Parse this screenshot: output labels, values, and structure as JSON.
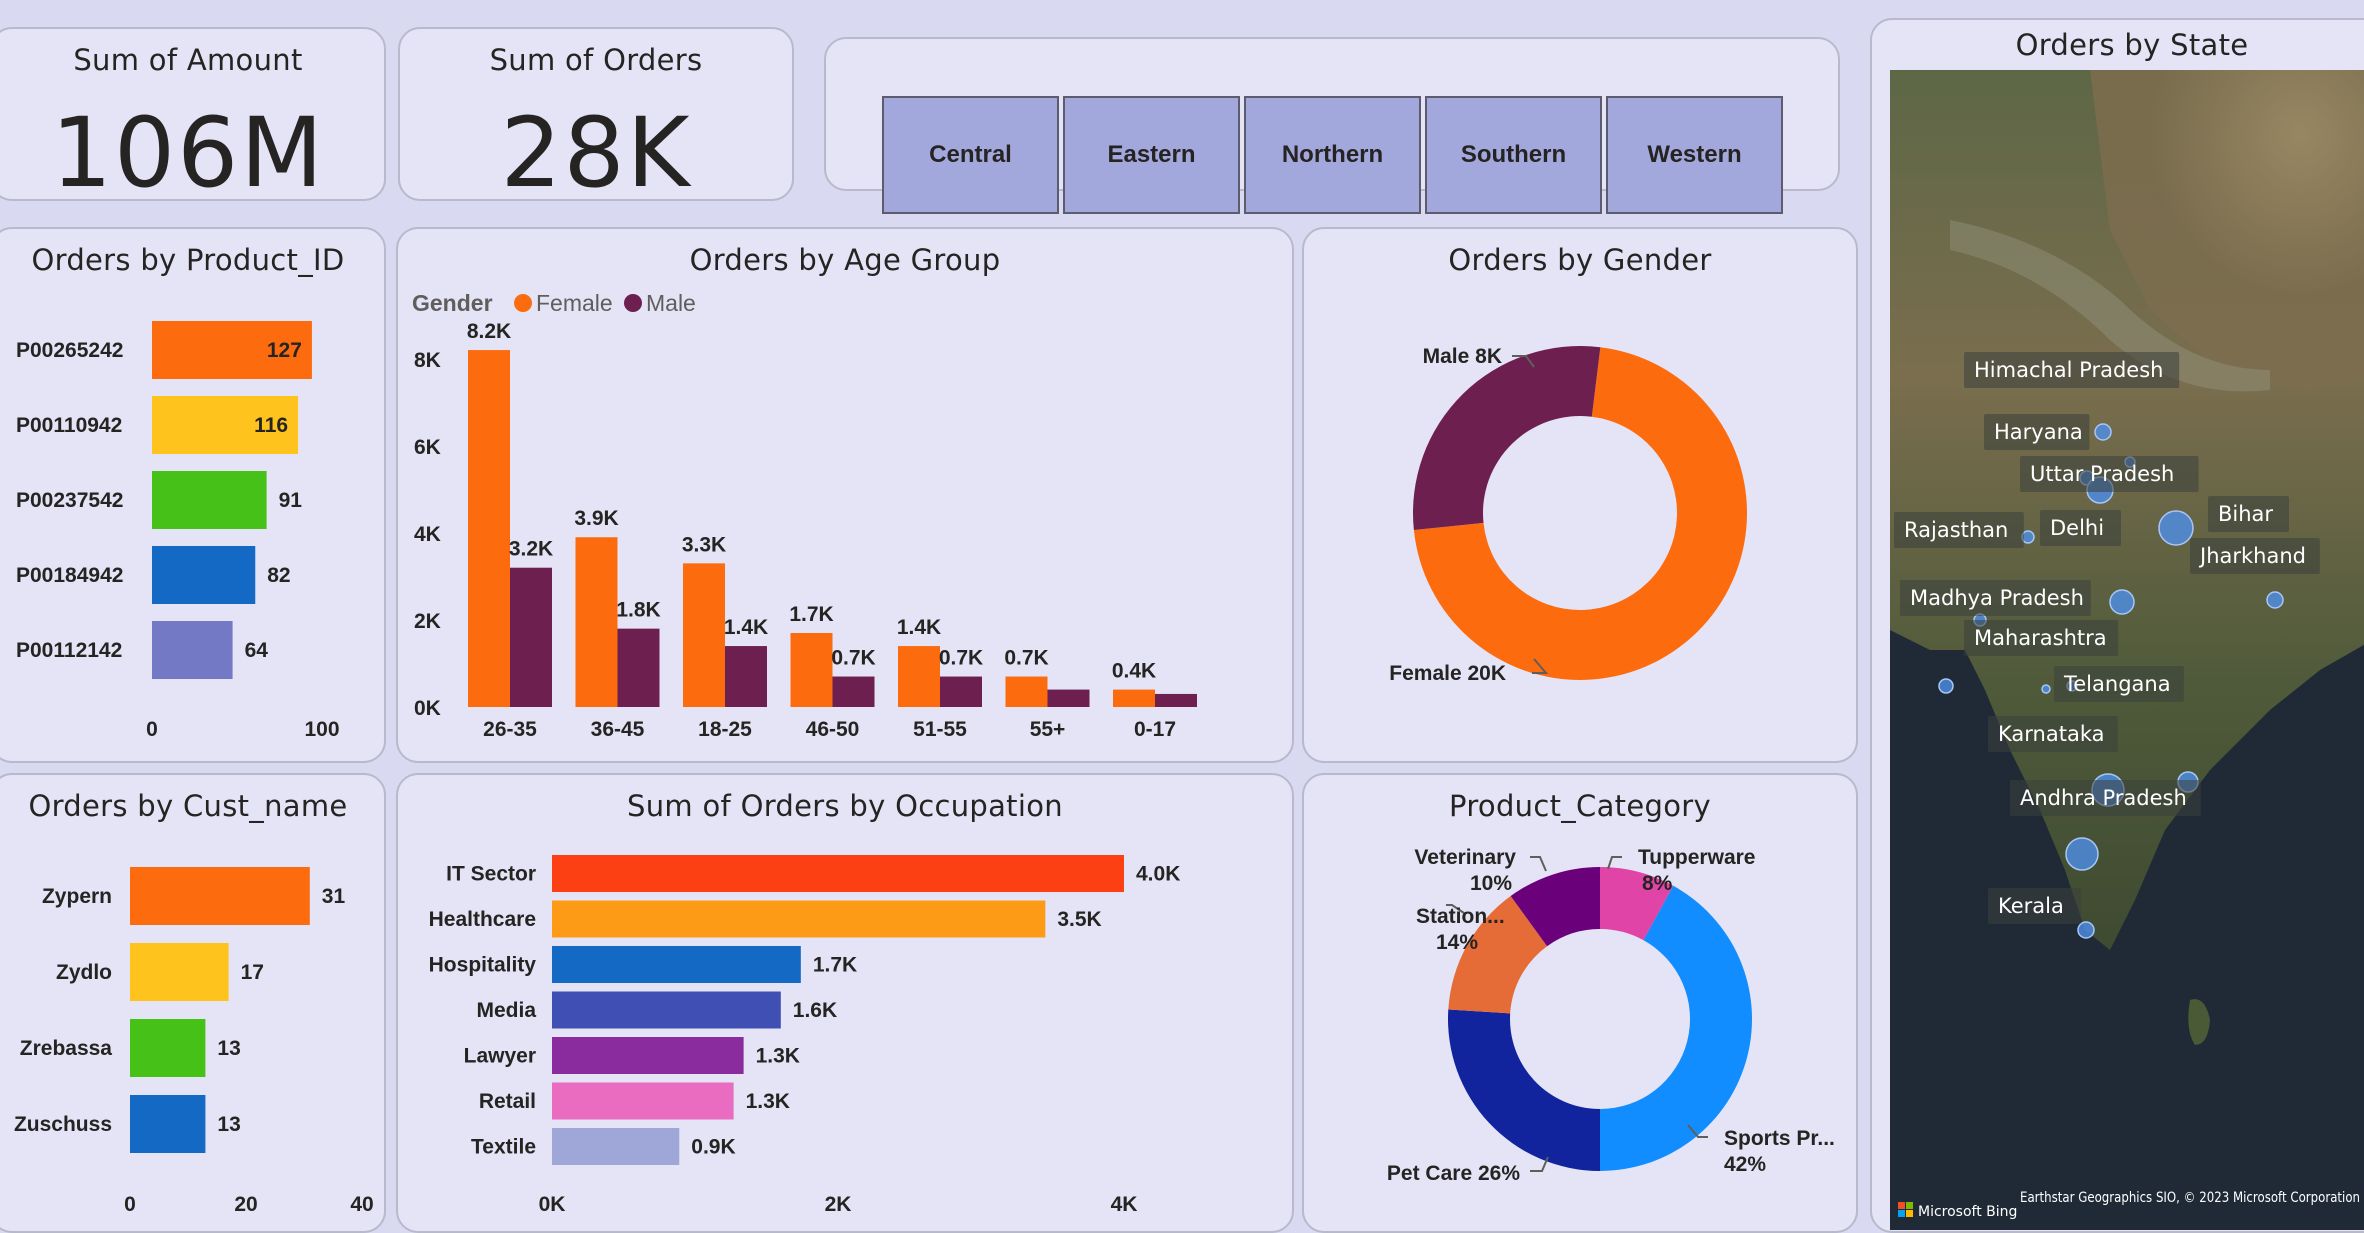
{
  "kpis": {
    "amount": {
      "title": "Sum of Amount",
      "value": "106M"
    },
    "orders": {
      "title": "Sum of Orders",
      "value": "28K"
    }
  },
  "slicer": {
    "items": [
      "Central",
      "Eastern",
      "Northern",
      "Southern",
      "Western"
    ]
  },
  "map": {
    "title": "Orders by State",
    "attribution": "Earthstar Geographics SIO, © 2023 Microsoft Corporation",
    "bing_label": "Microsoft Bing",
    "states": [
      "Himachal Pradesh",
      "Haryana",
      "Uttar Pradesh",
      "Bihar",
      "Rajasthan",
      "Delhi",
      "Jharkhand",
      "Madhya Pradesh",
      "Maharashtra",
      "Telangana",
      "Karnataka",
      "Andhra Pradesh",
      "Kerala"
    ],
    "colors": {
      "bubble": "#4e8fe8"
    }
  },
  "chart_data": [
    {
      "id": "product",
      "type": "bar",
      "orientation": "horizontal",
      "title": "Orders by Product_ID",
      "categories": [
        "P00265242",
        "P00110942",
        "P00237542",
        "P00184942",
        "P00112142"
      ],
      "values": [
        127,
        116,
        91,
        82,
        64
      ],
      "labels": [
        "127",
        "116",
        "91",
        "82",
        "64"
      ],
      "colors": [
        "#fd6b0f",
        "#fec31d",
        "#45c118",
        "#1469c4",
        "#7479c6"
      ],
      "xticks": [
        "0",
        "100"
      ],
      "xlim": [
        0,
        135
      ]
    },
    {
      "id": "age",
      "type": "bar",
      "title": "Orders by Age Group",
      "legend_title": "Gender",
      "categories": [
        "26-35",
        "36-45",
        "18-25",
        "46-50",
        "51-55",
        "55+",
        "0-17"
      ],
      "series": [
        {
          "name": "Female",
          "color": "#fd6b0f",
          "values": [
            8200,
            3900,
            3300,
            1700,
            1400,
            700,
            400
          ],
          "labels": [
            "8.2K",
            "3.9K",
            "3.3K",
            "1.7K",
            "1.4K",
            "0.7K",
            "0.4K"
          ]
        },
        {
          "name": "Male",
          "color": "#6d1f4f",
          "values": [
            3200,
            1800,
            1400,
            700,
            700,
            400,
            300
          ],
          "labels": [
            "3.2K",
            "1.8K",
            "1.4K",
            "0.7K",
            "0.7K",
            "",
            ""
          ]
        }
      ],
      "yticks": [
        "0K",
        "2K",
        "4K",
        "6K",
        "8K"
      ],
      "ylim": [
        0,
        8500
      ]
    },
    {
      "id": "gender",
      "type": "pie",
      "title": "Orders by Gender",
      "slices": [
        {
          "name": "Female",
          "value": 20000,
          "label": "Female 20K",
          "color": "#fd6b0f"
        },
        {
          "name": "Male",
          "value": 8000,
          "label": "Male 8K",
          "color": "#6d1f4f"
        }
      ]
    },
    {
      "id": "cust",
      "type": "bar",
      "orientation": "horizontal",
      "title": "Orders by Cust_name",
      "categories": [
        "Zypern",
        "Zydlo",
        "Zrebassa",
        "Zuschuss"
      ],
      "values": [
        31,
        17,
        13,
        13
      ],
      "labels": [
        "31",
        "17",
        "13",
        "13"
      ],
      "colors": [
        "#fd6b0f",
        "#fec31d",
        "#45c118",
        "#1469c4"
      ],
      "xticks": [
        "0",
        "20",
        "40"
      ],
      "xlim": [
        0,
        40
      ]
    },
    {
      "id": "occupation",
      "type": "bar",
      "orientation": "horizontal",
      "title": "Sum of Orders by Occupation",
      "categories": [
        "IT Sector",
        "Healthcare",
        "Hospitality",
        "Media",
        "Lawyer",
        "Retail",
        "Textile"
      ],
      "values": [
        4000,
        3450,
        1740,
        1600,
        1340,
        1270,
        890
      ],
      "labels": [
        "4.0K",
        "3.5K",
        "1.7K",
        "1.6K",
        "1.3K",
        "1.3K",
        "0.9K"
      ],
      "colors": [
        "#fd3f14",
        "#fe9b16",
        "#1469c4",
        "#3f4fb3",
        "#8a2b9e",
        "#e96cc0",
        "#9fa6d8"
      ],
      "xticks": [
        "0K",
        "2K",
        "4K"
      ],
      "xlim": [
        0,
        4000
      ]
    },
    {
      "id": "category",
      "type": "pie",
      "title": "Product_Category",
      "slices": [
        {
          "name": "Sports Pr...",
          "value": 42,
          "label1": "Sports Pr...",
          "label2": "42%",
          "color": "#118dff"
        },
        {
          "name": "Pet Care",
          "value": 26,
          "label1": "Pet Care 26%",
          "label2": "",
          "color": "#12239e"
        },
        {
          "name": "Station...",
          "value": 14,
          "label1": "Station...",
          "label2": "14%",
          "color": "#e66c37"
        },
        {
          "name": "Veterinary",
          "value": 10,
          "label1": "Veterinary",
          "label2": "10%",
          "color": "#6b007b"
        },
        {
          "name": "Tupperware",
          "value": 8,
          "label1": "Tupperware",
          "label2": "8%",
          "color": "#e044a7"
        }
      ]
    }
  ]
}
